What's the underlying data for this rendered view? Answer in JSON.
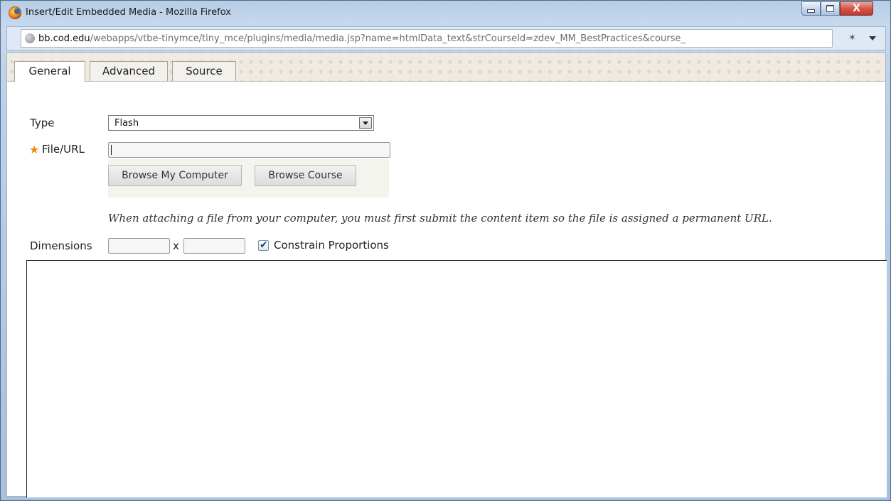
{
  "window": {
    "title": "Insert/Edit Embedded Media - Mozilla Firefox",
    "controls": {
      "minimize": "–",
      "maximize": "□",
      "close": "X"
    }
  },
  "address_bar": {
    "domain": "bb.cod.edu",
    "path": "/webapps/vtbe-tinymce/tiny_mce/plugins/media/media.jsp?name=htmlData_text&strCourseId=zdev_MM_BestPractices&course_"
  },
  "tabs": [
    {
      "label": "General",
      "active": true
    },
    {
      "label": "Advanced",
      "active": false
    },
    {
      "label": "Source",
      "active": false
    }
  ],
  "form": {
    "type_label": "Type",
    "type_value": "Flash",
    "required_mark": "★",
    "file_label": "File/URL",
    "file_value": "",
    "browse_computer": "Browse My Computer",
    "browse_course": "Browse Course",
    "note": "When attaching a file from your computer, you must first submit the content item so the file is assigned a permanent URL.",
    "dimensions_label": "Dimensions",
    "width_value": "",
    "height_value": "",
    "separator": "x",
    "constrain_label": "Constrain Proportions",
    "constrain_checked": true
  },
  "icons": {
    "app": "firefox-icon",
    "site": "globe-icon",
    "addon": "addon-icon",
    "menu": "dropdown-arrow-icon"
  }
}
